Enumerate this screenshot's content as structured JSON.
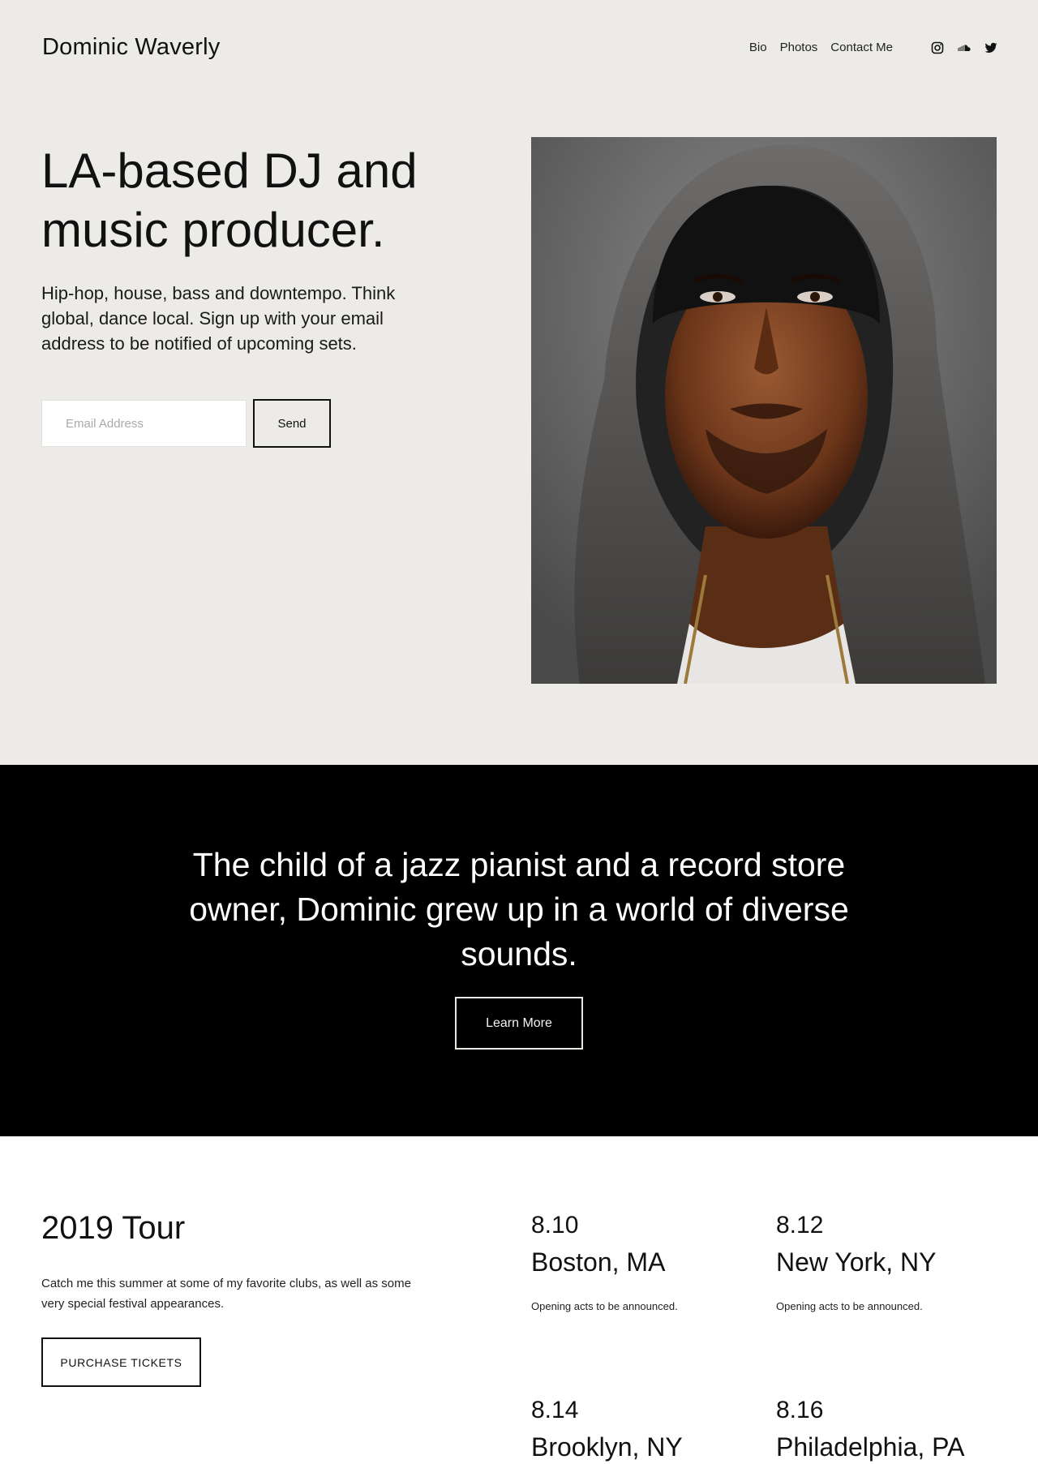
{
  "brand": "Dominic Waverly",
  "nav": {
    "links": [
      "Bio",
      "Photos",
      "Contact Me"
    ],
    "social_icons": [
      "instagram-icon",
      "soundcloud-icon",
      "twitter-icon"
    ]
  },
  "hero": {
    "headline": "LA-based DJ and music producer.",
    "subcopy": "Hip-hop, house, bass and downtempo. Think global, dance local. Sign up with your email address to be notified of upcoming sets.",
    "email_placeholder": "Email Address",
    "send_label": "Send",
    "portrait_alt": "Portrait of Dominic Waverly in a gray hoodie and black beanie"
  },
  "band": {
    "quote": "The child of a jazz pianist and a record store owner, Dominic grew up in a world of diverse sounds.",
    "button_label": "Learn More"
  },
  "tour": {
    "title": "2019 Tour",
    "description": "Catch me this summer at some of my favorite clubs, as well as some very special festival appearances.",
    "button_label": "PURCHASE TICKETS",
    "shows": [
      {
        "date": "8.10",
        "city": "Boston, MA",
        "note": "Opening acts to be announced."
      },
      {
        "date": "8.12",
        "city": "New York, NY",
        "note": "Opening acts to be announced."
      },
      {
        "date": "8.14",
        "city": "Brooklyn, NY",
        "note": ""
      },
      {
        "date": "8.16",
        "city": "Philadelphia, PA",
        "note": ""
      }
    ]
  },
  "colors": {
    "hero_bg": "#ecebe8",
    "band_bg": "#000000",
    "text": "#111111"
  }
}
